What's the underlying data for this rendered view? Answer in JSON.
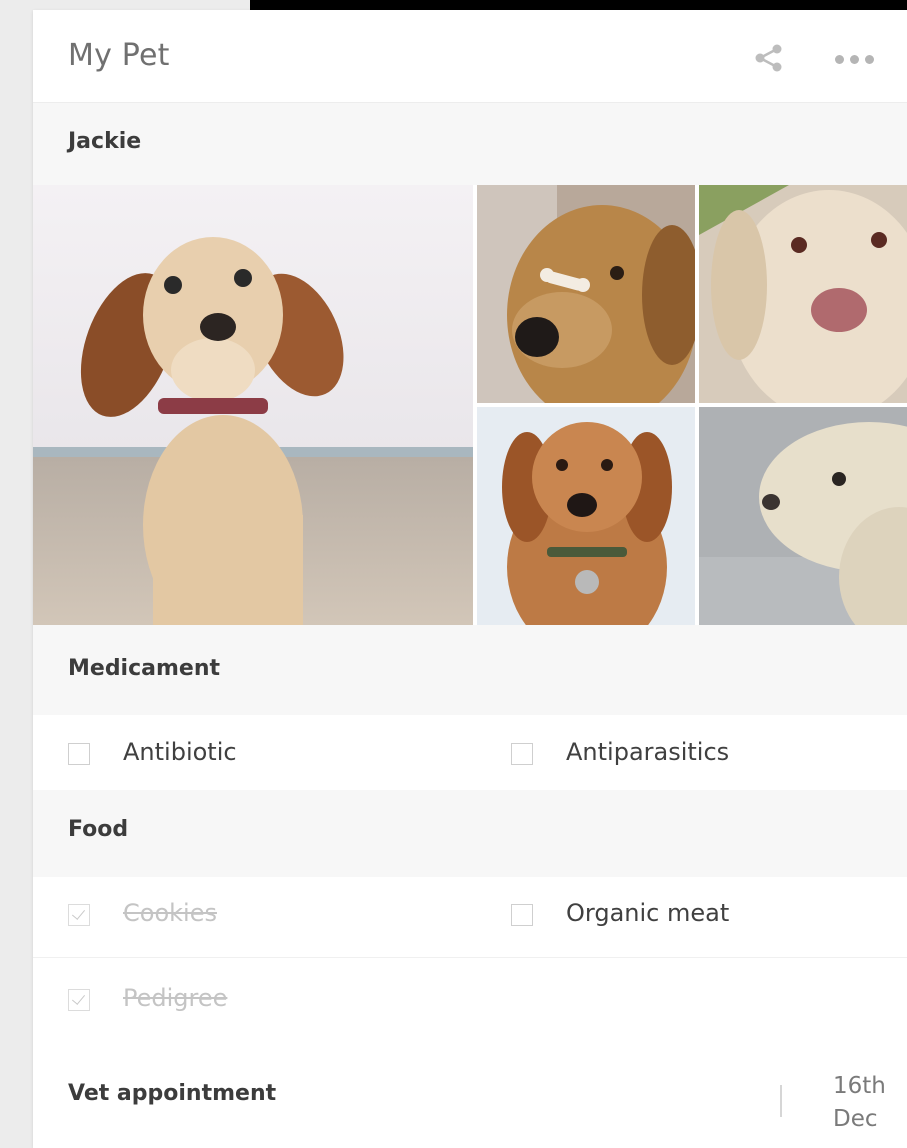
{
  "app": {
    "title": "My Pet"
  },
  "header": {
    "share_icon": "share-icon",
    "more_icon": "more-horizontal-icon"
  },
  "pet": {
    "name": "Jackie"
  },
  "gallery": {
    "photos": [
      "main-photo",
      "photo-2",
      "photo-3",
      "photo-4",
      "photo-5"
    ]
  },
  "medicament": {
    "title": "Medicament",
    "items": [
      {
        "label": "Antibiotic",
        "checked": false
      },
      {
        "label": "Antiparasitics",
        "checked": false
      }
    ]
  },
  "food": {
    "title": "Food",
    "items": [
      {
        "label": "Cookies",
        "checked": true
      },
      {
        "label": "Organic meat",
        "checked": false
      },
      {
        "label": "Pedigree",
        "checked": true
      }
    ]
  },
  "vet": {
    "title": "Vet appointment",
    "date_day": "16th",
    "date_month": "Dec"
  },
  "colors": {
    "header_bg": "#ffffff",
    "section_bg": "#f7f7f7",
    "text_dark": "#3c3c3c",
    "muted": "#c4c4c4"
  }
}
